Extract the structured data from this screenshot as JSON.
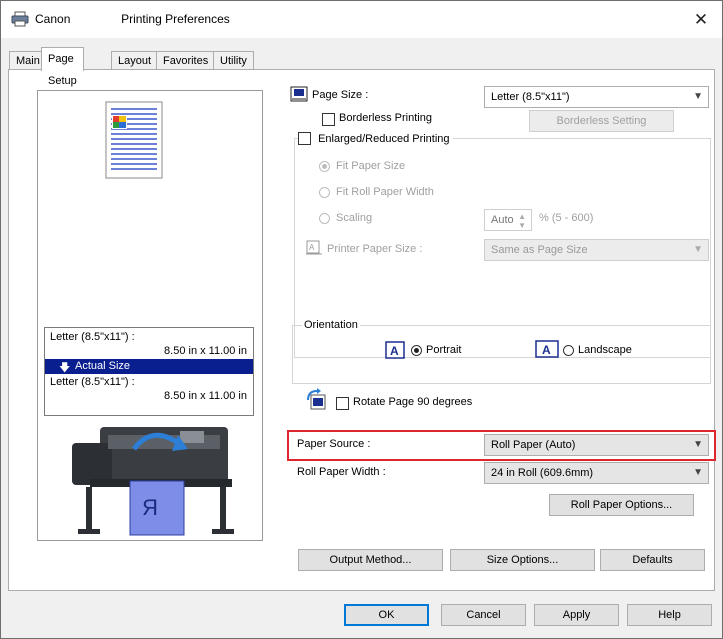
{
  "window": {
    "title_prefix": "Canon",
    "title_suffix": "Printing Preferences",
    "close_glyph": "✕"
  },
  "tabs": [
    {
      "label": "Main"
    },
    {
      "label": "Page Setup"
    },
    {
      "label": "Layout"
    },
    {
      "label": "Favorites"
    },
    {
      "label": "Utility"
    }
  ],
  "preview": {
    "info_top_line1": "Letter (8.5\"x11\") :",
    "info_top_line2": "8.50 in x 11.00 in",
    "actual_size_label": "Actual Size",
    "info_bottom_line1": "Letter (8.5\"x11\") :",
    "info_bottom_line2": "8.50 in x 11.00 in"
  },
  "page_size": {
    "label": "Page Size :",
    "value": "Letter (8.5\"x11\")"
  },
  "borderless_printing": {
    "label": "Borderless Printing",
    "checked": false
  },
  "borderless_setting_button": "Borderless Setting",
  "enlarged_reduced": {
    "label": "Enlarged/Reduced Printing",
    "checked": false,
    "fit_paper_size": "Fit Paper Size",
    "fit_roll_paper_width": "Fit Roll Paper Width",
    "scaling": "Scaling",
    "scaling_value": "Auto",
    "scaling_range": "% (5 - 600)",
    "printer_paper_size_label": "Printer Paper Size :",
    "printer_paper_size_value": "Same as Page Size"
  },
  "orientation": {
    "label": "Orientation",
    "portrait": "Portrait",
    "landscape": "Landscape",
    "selected": "Portrait"
  },
  "rotate_page": {
    "label": "Rotate Page 90 degrees",
    "checked": false
  },
  "paper_source": {
    "label": "Paper Source :",
    "value": "Roll Paper (Auto)"
  },
  "roll_paper_width": {
    "label": "Roll Paper Width :",
    "value": "24 in Roll (609.6mm)"
  },
  "roll_paper_options_button": "Roll Paper Options...",
  "bottom_buttons": {
    "output_method": "Output Method...",
    "size_options": "Size Options...",
    "defaults": "Defaults"
  },
  "dialog_buttons": {
    "ok": "OK",
    "cancel": "Cancel",
    "apply": "Apply",
    "help": "Help"
  },
  "colors": {
    "highlight_box": "#e0262d",
    "selection_bar": "#0a1f8f",
    "default_button_border": "#0078d7"
  }
}
